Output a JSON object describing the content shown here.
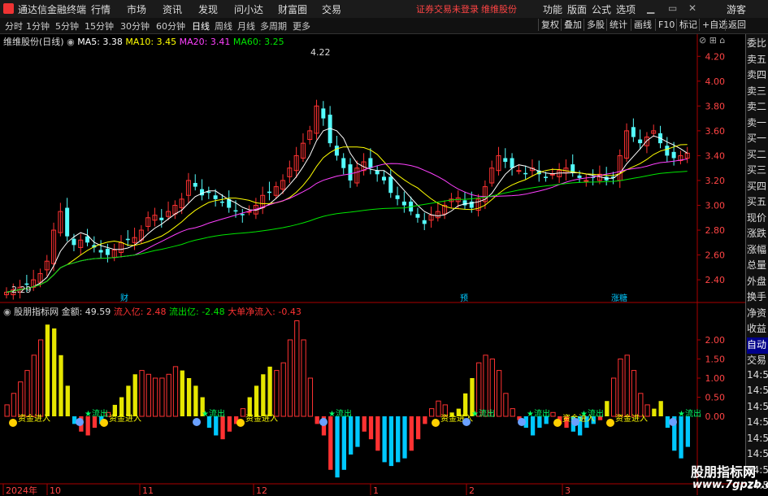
{
  "menubar": {
    "app_title": "通达信金融终端",
    "menus": [
      "行情",
      "市场",
      "资讯",
      "发现",
      "问小达",
      "财富圈",
      "交易"
    ],
    "notice": "证券交易未登录",
    "notice_name": "维维股份",
    "right_menus": [
      "功能",
      "版面",
      "公式",
      "选项"
    ],
    "user": "游客"
  },
  "periods": [
    "分时",
    "1分钟",
    "5分钟",
    "15分钟",
    "30分钟",
    "60分钟",
    "日线",
    "周线",
    "月线",
    "多周期",
    "更多"
  ],
  "active_period": "日线",
  "tools": [
    "复权",
    "叠加",
    "多股",
    "统计",
    "画线",
    "F10",
    "标记",
    "+自选",
    "返回"
  ],
  "main_legend": {
    "stock": "维维股份(日线)",
    "ma5": "MA5: 3.38",
    "ma10": "MA10: 3.45",
    "ma20": "MA20: 3.41",
    "ma60": "MA60: 3.25"
  },
  "sub_legend": {
    "name": "股朋指标网",
    "amount": "金额: 49.59",
    "inflow": "流入亿: 2.48",
    "outflow": "流出亿: -2.48",
    "net": "大单净流入: -0.43"
  },
  "y_axis_main": [
    "4.20",
    "4.00",
    "3.80",
    "3.60",
    "3.40",
    "3.20",
    "3.00",
    "2.80",
    "2.60",
    "2.40"
  ],
  "y_axis_sub": [
    "2.00",
    "1.50",
    "1.00",
    "0.50",
    "0.00"
  ],
  "annotations": {
    "high_label": "4.22",
    "low_label": "2.29",
    "markers": [
      "财",
      "预",
      "涨糖"
    ],
    "bubble_in": "资金进入",
    "bubble_out": "流出"
  },
  "x_axis": [
    "2024年",
    "10",
    "11",
    "12",
    "1",
    "2",
    "3"
  ],
  "right_panel": [
    "委比",
    "卖五",
    "卖四",
    "卖三",
    "卖二",
    "卖一",
    "买一",
    "买二",
    "买三",
    "买四",
    "买五",
    "现价",
    "涨跌",
    "涨幅",
    "总量",
    "外盘",
    "换手",
    "净资",
    "收益",
    "自动",
    "交易",
    "14:56",
    "14:56",
    "14:56",
    "14:56",
    "14:56",
    "14:56",
    "14:56",
    "14:56"
  ],
  "watermark": {
    "title": "股朋指标网",
    "url": "www.7gpzb.com"
  },
  "colors": {
    "up": "#ff3232",
    "down": "#54fcfc",
    "ma5": "#ffffff",
    "ma10": "#ffff00",
    "ma20": "#ff40ff",
    "ma60": "#00e600",
    "yellow_bar": "#e6e600",
    "blue_bar": "#00c8ff"
  },
  "chart_data": {
    "type": "candlestick",
    "title": "维维股份(日线)",
    "ylim": [
      2.25,
      4.3
    ],
    "closes": [
      2.3,
      2.32,
      2.34,
      2.36,
      2.4,
      2.45,
      2.55,
      2.8,
      2.95,
      2.75,
      2.68,
      2.72,
      2.7,
      2.66,
      2.62,
      2.6,
      2.64,
      2.7,
      2.72,
      2.74,
      2.8,
      2.9,
      2.92,
      2.88,
      2.95,
      3.0,
      3.05,
      3.2,
      3.15,
      3.08,
      3.1,
      3.05,
      3.02,
      2.98,
      2.95,
      2.92,
      2.95,
      3.0,
      3.08,
      3.1,
      3.15,
      3.2,
      3.3,
      3.4,
      3.5,
      3.6,
      3.8,
      3.7,
      3.5,
      3.4,
      3.3,
      3.2,
      3.3,
      3.35,
      3.3,
      3.25,
      3.2,
      3.1,
      3.05,
      3.0,
      2.95,
      2.9,
      2.85,
      2.92,
      2.95,
      3.0,
      3.05,
      3.06,
      3.0,
      2.98,
      3.05,
      3.15,
      3.3,
      3.4,
      3.35,
      3.3,
      3.28,
      3.25,
      3.3,
      3.25,
      3.22,
      3.25,
      3.28,
      3.3,
      3.26,
      3.22,
      3.2,
      3.22,
      3.25,
      3.2,
      3.22,
      3.4,
      3.6,
      3.55,
      3.5,
      3.55,
      3.6,
      3.5,
      3.4,
      3.38,
      3.4,
      3.42
    ],
    "sub_bars": [
      0.3,
      0.6,
      0.9,
      1.2,
      1.6,
      2.0,
      2.4,
      2.3,
      1.6,
      0.8,
      -0.2,
      -0.4,
      -0.5,
      -0.3,
      -0.2,
      0.1,
      0.3,
      0.5,
      0.8,
      1.1,
      1.2,
      1.1,
      1.0,
      1.0,
      1.1,
      1.3,
      1.2,
      1.0,
      0.8,
      0.5,
      -0.3,
      -0.5,
      -0.6,
      -0.4,
      -0.2,
      0.2,
      0.5,
      0.8,
      1.1,
      1.3,
      1.2,
      1.4,
      2.0,
      2.5,
      2.0,
      1.0,
      -0.2,
      -0.5,
      -1.4,
      -1.6,
      -1.4,
      -1.0,
      -0.8,
      -0.4,
      -0.6,
      -0.9,
      -1.2,
      -1.3,
      -1.2,
      -1.1,
      -0.9,
      -0.6,
      -0.2,
      0.2,
      0.4,
      0.3,
      0.1,
      0.2,
      0.6,
      1.0,
      1.4,
      1.6,
      1.5,
      1.2,
      0.6,
      0.2,
      -0.1,
      -0.3,
      -0.5,
      -0.3,
      -0.2,
      0.1,
      -0.2,
      -0.3,
      -0.4,
      -0.5,
      -0.3,
      -0.2,
      -0.1,
      0.4,
      1.0,
      1.5,
      1.6,
      1.2,
      0.6,
      0.3,
      0.2,
      0.4,
      -0.3,
      -0.9,
      -1.1,
      -0.8
    ]
  }
}
